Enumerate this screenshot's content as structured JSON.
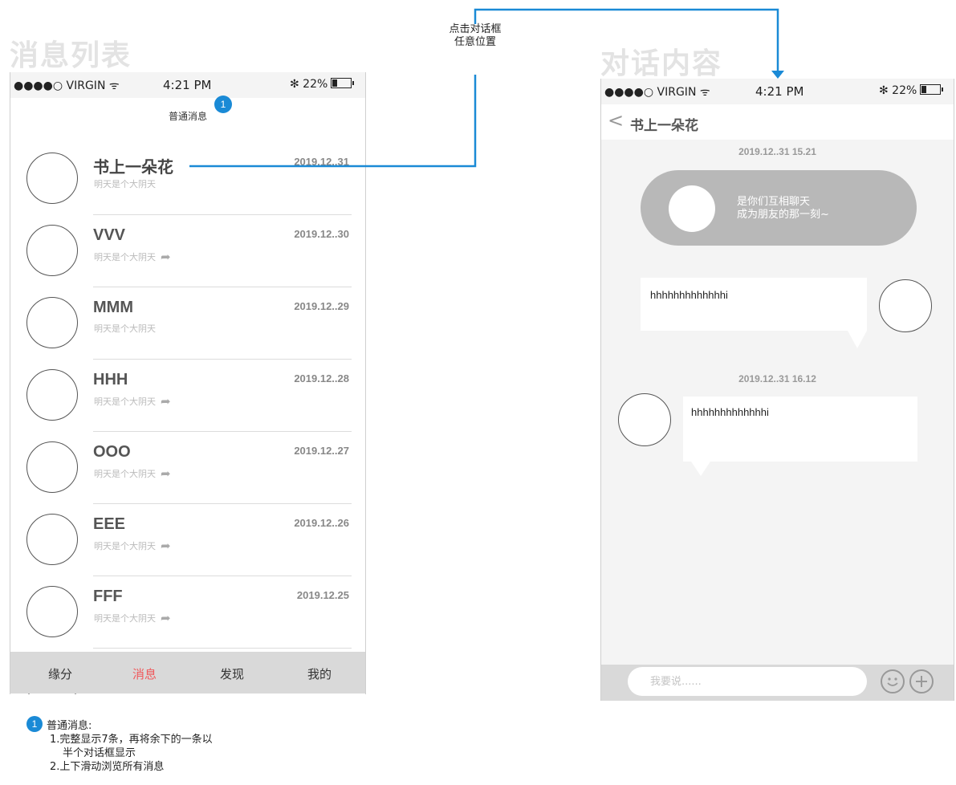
{
  "titles": {
    "left": "消息列表",
    "right": "对话内容"
  },
  "statusbar": {
    "carrier": "●●●●○ VIRGIN ᯤ",
    "time": "4:21 PM",
    "battery_text": "✻ 22%"
  },
  "list_screen": {
    "nav_title": "普通消息",
    "marker": "1",
    "items": [
      {
        "name": "书上一朵花",
        "preview": "明天是个大阴天",
        "date": "2019.12..31",
        "forward": false
      },
      {
        "name": "VVV",
        "preview": "明天是个大阴天",
        "date": "2019.12..30",
        "forward": true
      },
      {
        "name": "MMM",
        "preview": "明天是个大阴天",
        "date": "2019.12..29",
        "forward": false
      },
      {
        "name": "HHH",
        "preview": "明天是个大阴天",
        "date": "2019.12..28",
        "forward": true
      },
      {
        "name": "OOO",
        "preview": "明天是个大阴天",
        "date": "2019.12..27",
        "forward": true
      },
      {
        "name": "EEE",
        "preview": "明天是个大阴天",
        "date": "2019.12..26",
        "forward": true
      },
      {
        "name": "FFF",
        "preview": "明天是个大阴天",
        "date": "2019.12.25",
        "forward": true
      }
    ],
    "tabs": [
      "缘分",
      "消息",
      "发现",
      "我的"
    ],
    "active_tab": "消息",
    "active_color": "#f0595c"
  },
  "chat_screen": {
    "title": "书上一朵花",
    "back_icon": "chevron-left-icon",
    "timestamp1": "2019.12..31 15.21",
    "system_card": {
      "line1": "是你们互相聊天",
      "line2": "成为朋友的那一刻~"
    },
    "message_outgoing": "hhhhhhhhhhhhhi",
    "timestamp2": "2019.12..31  16.12",
    "message_incoming": "hhhhhhhhhhhhhi",
    "input_placeholder": "我要说......",
    "emoji_icon": "smiley-icon",
    "plus_icon": "plus-circle-icon"
  },
  "annotation": {
    "line1": "点击对话框",
    "line2": "任意位置",
    "connector_color": "#1a8ad6"
  },
  "notes": {
    "marker": "1",
    "title": "普通消息:",
    "line1": "1.完整显示7条，再将余下的一条以",
    "line2": "半个对话框显示",
    "line3": "2.上下滑动浏览所有消息"
  }
}
